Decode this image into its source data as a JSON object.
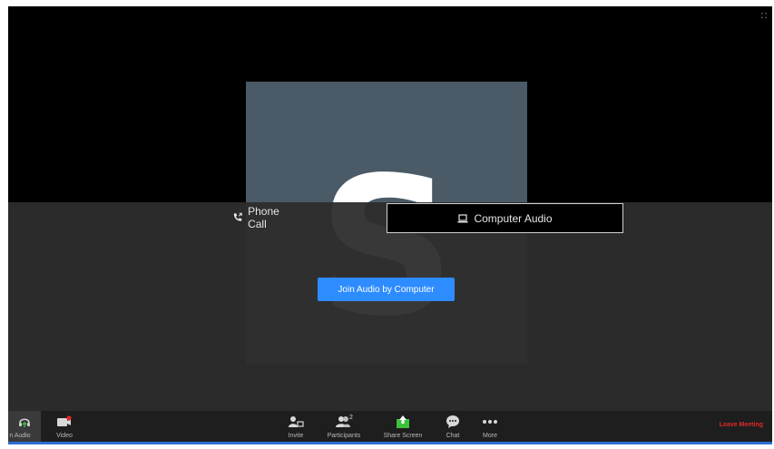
{
  "window": {
    "fullscreen_icon": "fullscreen-icon"
  },
  "video": {
    "avatar_letter": "S",
    "tile_color": "#4a5a66"
  },
  "audio_dialog": {
    "tabs": [
      {
        "label": "Phone Call",
        "icon": "phone-icon",
        "selected": false
      },
      {
        "label": "Computer Audio",
        "icon": "laptop-icon",
        "selected": true
      }
    ],
    "join_button_label": "Join Audio by Computer",
    "accent": "#2d8cff"
  },
  "toolbar": {
    "audio_label": "n Audio",
    "video_label": "Video",
    "invite_label": "Invite",
    "participants_label": "Participants",
    "participants_count": "2",
    "share_label": "Share Screen",
    "chat_label": "Chat",
    "more_label": "More",
    "leave_label": "Leave Meeting",
    "leave_color": "#e02828",
    "share_color": "#3cc13c"
  }
}
